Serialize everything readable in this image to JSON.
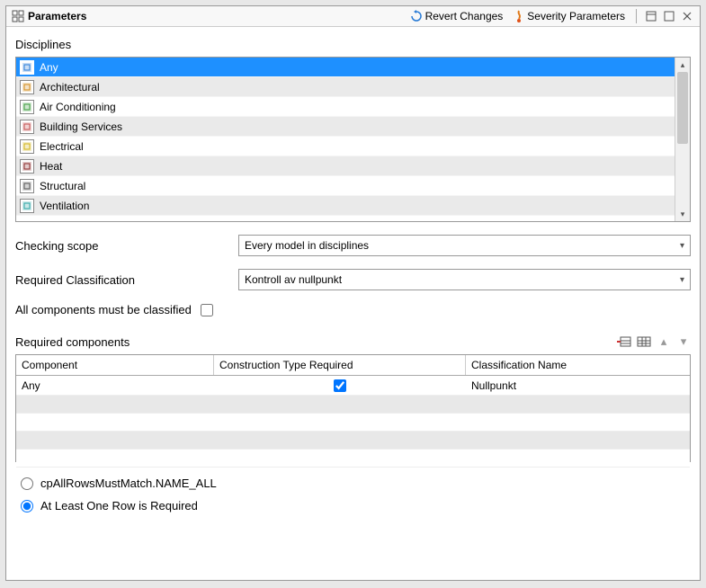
{
  "title": "Parameters",
  "toolbar": {
    "revert": "Revert Changes",
    "severity": "Severity Parameters"
  },
  "labels": {
    "disciplines": "Disciplines",
    "checking_scope": "Checking scope",
    "required_classification": "Required Classification",
    "all_classified": "All components must be classified",
    "required_components": "Required components"
  },
  "disciplines": [
    {
      "label": "Any",
      "selected": true,
      "iconColor": "#2a7cd6"
    },
    {
      "label": "Architectural",
      "iconColor": "#d18a1a"
    },
    {
      "label": "Air Conditioning",
      "iconColor": "#3a9a3a"
    },
    {
      "label": "Building Services",
      "iconColor": "#c24d4d"
    },
    {
      "label": "Electrical",
      "iconColor": "#d1b31a"
    },
    {
      "label": "Heat",
      "iconColor": "#8a2a2a"
    },
    {
      "label": "Structural",
      "iconColor": "#555555"
    },
    {
      "label": "Ventilation",
      "iconColor": "#2aa5a5"
    }
  ],
  "checking_scope": {
    "value": "Every model in disciplines"
  },
  "required_classification": {
    "value": "Kontroll av nullpunkt"
  },
  "all_classified_checked": false,
  "grid": {
    "headers": {
      "component": "Component",
      "ctr": "Construction Type Required",
      "classname": "Classification Name"
    },
    "rows": [
      {
        "component": "Any",
        "ctr": true,
        "classname": "Nullpunkt"
      }
    ]
  },
  "radios": {
    "all_match": "cpAllRowsMustMatch.NAME_ALL",
    "one_required": "At Least One Row is Required",
    "selected": "one_required"
  }
}
